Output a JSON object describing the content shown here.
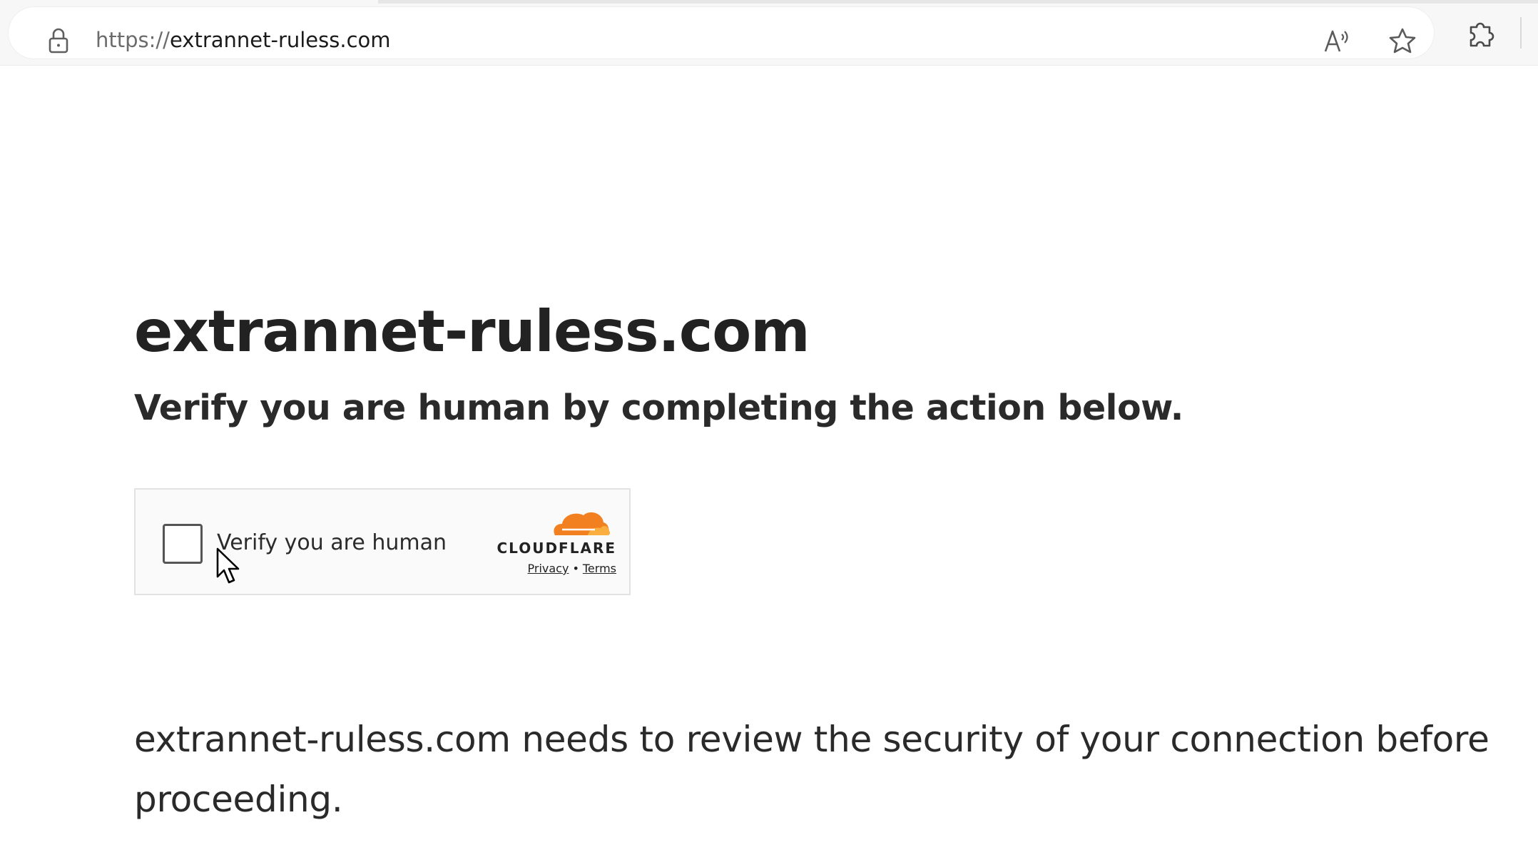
{
  "browser": {
    "url_scheme": "https://",
    "url_host": "extrannet-ruless.com",
    "icons": {
      "lock": "lock-icon",
      "read_aloud": "read-aloud-icon",
      "favorite": "star-icon",
      "extensions": "puzzle-icon"
    }
  },
  "page": {
    "title": "extrannet-ruless.com",
    "subtitle": "Verify you are human by completing the action below.",
    "security_message": "extrannet-ruless.com needs to review the security of your connection before proceeding."
  },
  "widget": {
    "checkbox_label": "Verify you are human",
    "brand": "CLOUDFLARE",
    "privacy_link": "Privacy",
    "separator": "•",
    "terms_link": "Terms",
    "checked": false
  },
  "colors": {
    "cloudflare_orange": "#f38020",
    "cloudflare_light_orange": "#faae40",
    "text_dark": "#222222"
  }
}
